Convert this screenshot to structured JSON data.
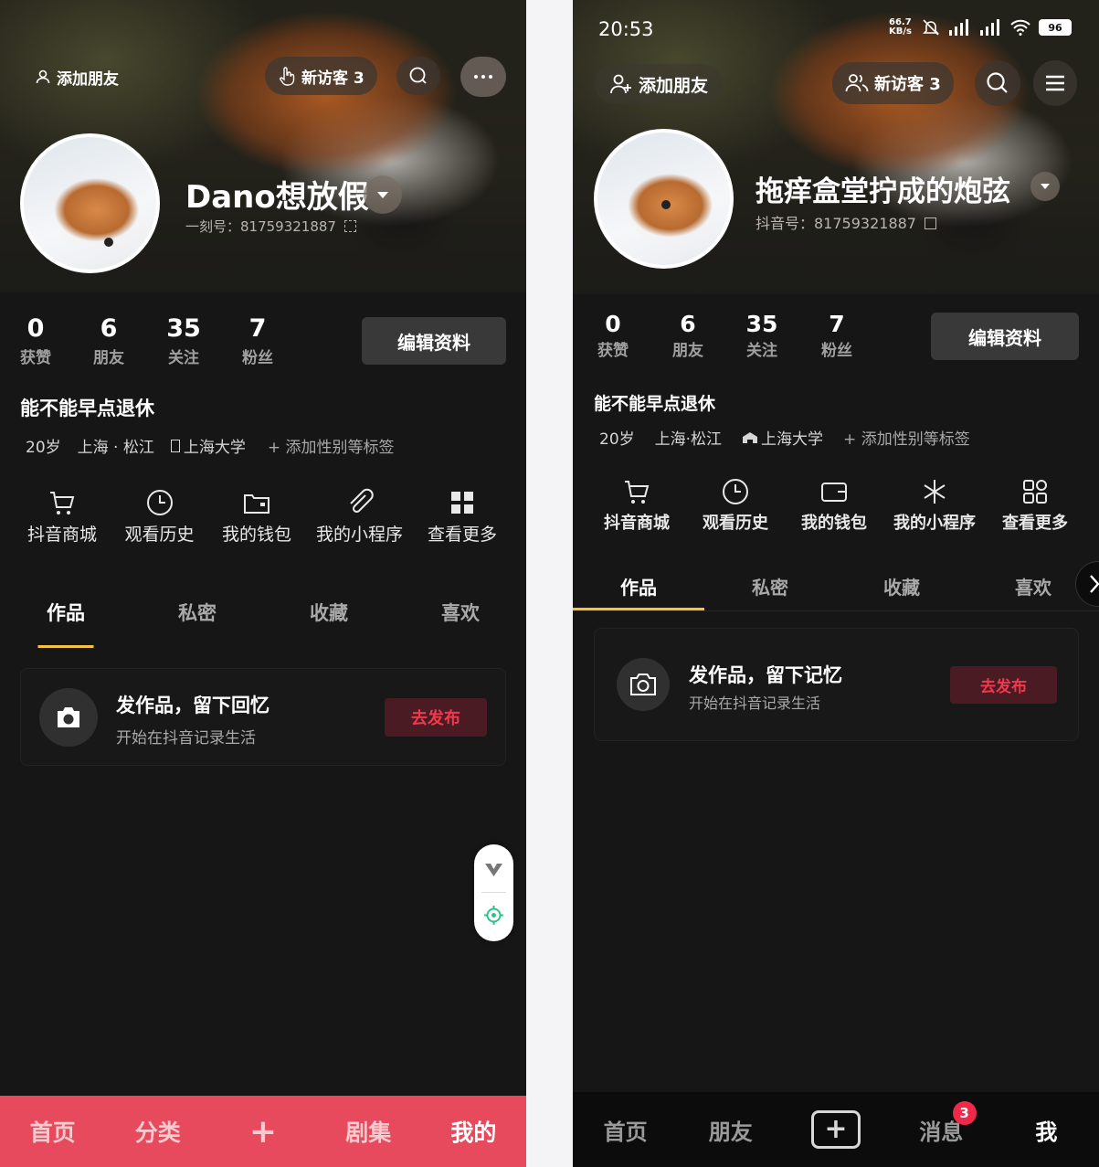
{
  "left": {
    "header": {
      "add_friend": "添加朋友",
      "new_visitors": "新访客 3"
    },
    "profile": {
      "username": "Dano想放假",
      "id_label": "一刻号：81759321887"
    },
    "stats": [
      {
        "num": "0",
        "label": "获赞"
      },
      {
        "num": "6",
        "label": "朋友"
      },
      {
        "num": "35",
        "label": "关注"
      },
      {
        "num": "7",
        "label": "粉丝"
      }
    ],
    "edit_profile": "编辑资料",
    "bio": "能不能早点退休",
    "tags": {
      "age": "20岁",
      "location": "上海 · 松江",
      "school": "上海大学",
      "add_tag": "+ 添加性别等标签"
    },
    "tools": [
      {
        "label": "抖音商城",
        "icon": "cart-icon"
      },
      {
        "label": "观看历史",
        "icon": "clock-icon"
      },
      {
        "label": "我的钱包",
        "icon": "wallet-icon"
      },
      {
        "label": "我的小程序",
        "icon": "paperclip-icon"
      },
      {
        "label": "查看更多",
        "icon": "grid-icon"
      }
    ],
    "tabs": [
      "作品",
      "私密",
      "收藏",
      "喜欢"
    ],
    "post_card": {
      "title": "发作品，留下回忆",
      "subtitle": "开始在抖音记录生活",
      "button": "去发布"
    },
    "nav": [
      "首页",
      "分类",
      "+",
      "剧集",
      "我的"
    ]
  },
  "right": {
    "status_bar": {
      "time": "20:53",
      "net_speed": "66.7 KB/s",
      "battery": "96"
    },
    "header": {
      "add_friend": "添加朋友",
      "new_visitors": "新访客 3"
    },
    "profile": {
      "username": "拖痒盒堂拧成的炮弦",
      "id_label": "抖音号：81759321887"
    },
    "stats": [
      {
        "num": "0",
        "label": "获赞"
      },
      {
        "num": "6",
        "label": "朋友"
      },
      {
        "num": "35",
        "label": "关注"
      },
      {
        "num": "7",
        "label": "粉丝"
      }
    ],
    "edit_profile": "编辑资料",
    "bio": "能不能早点退休",
    "tags": {
      "age": "20岁",
      "location": "上海·松江",
      "school": "上海大学",
      "add_tag": "+ 添加性别等标签"
    },
    "tools": [
      {
        "label": "抖音商城",
        "icon": "cart-icon"
      },
      {
        "label": "观看历史",
        "icon": "clock-icon"
      },
      {
        "label": "我的钱包",
        "icon": "wallet-icon"
      },
      {
        "label": "我的小程序",
        "icon": "sparkle-icon"
      },
      {
        "label": "查看更多",
        "icon": "grid-outline-icon"
      }
    ],
    "tabs": [
      "作品",
      "私密",
      "收藏",
      "喜欢"
    ],
    "post_card": {
      "title": "发作品，留下记忆",
      "subtitle": "开始在抖音记录生活",
      "button": "去发布"
    },
    "nav": [
      "首页",
      "朋友",
      "+",
      "消息",
      "我"
    ],
    "message_badge": "3"
  },
  "colors": {
    "accent_yellow": "#f7c33d",
    "publish_red": "#f0384f",
    "left_nav_bg": "#e64a5c"
  }
}
